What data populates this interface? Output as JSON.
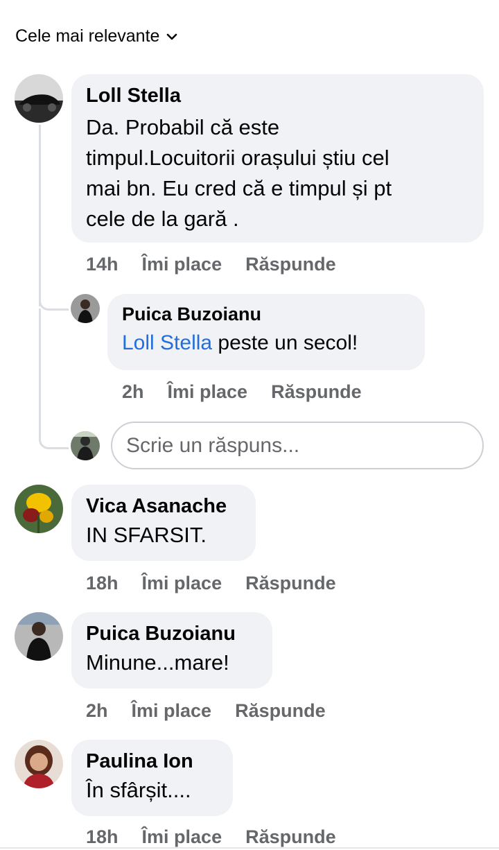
{
  "sort": {
    "label": "Cele mai relevante",
    "icon": "chevron-down-icon"
  },
  "actions_labels": {
    "like": "Îmi place",
    "reply": "Răspunde"
  },
  "comments": [
    {
      "author": "Loll Stella",
      "text": [
        "Da. Probabil că este",
        "timpul.Locuitorii orașului știu cel",
        "mai bn. Eu cred că e timpul și pt",
        "cele de la gară ."
      ],
      "time": "14h",
      "replies": [
        {
          "author": "Puica Buzoianu",
          "mention": "Loll Stella",
          "text": " peste un secol!",
          "time": "2h"
        }
      ]
    },
    {
      "author": "Vica Asanache",
      "text": "IN SFARSIT.",
      "time": "18h"
    },
    {
      "author": "Puica Buzoianu",
      "text": "Minune...mare!",
      "time": "2h"
    },
    {
      "author": "Paulina Ion",
      "text": "În sfârșit....",
      "time": "18h"
    }
  ],
  "reply_input": {
    "placeholder": "Scrie un răspuns..."
  },
  "colors": {
    "bubble": "#f0f2f5",
    "meta": "#65676b",
    "mention": "#216fdb",
    "text": "#050505"
  }
}
